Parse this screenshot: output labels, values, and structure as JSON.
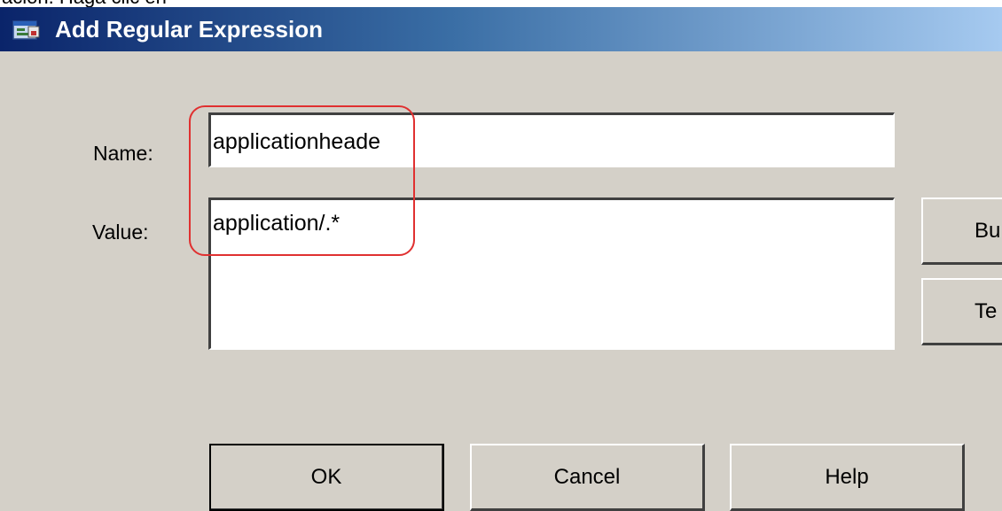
{
  "caption": "ación. Haga clic en",
  "dialog": {
    "title": "Add Regular Expression",
    "title_icon": "regex-app-icon",
    "name_label": "Name:",
    "name_value": "applicationheade",
    "value_label": "Value:",
    "value_value": "application/.*",
    "builder_label": "Bu",
    "test_label": "Te",
    "ok_label": "OK",
    "cancel_label": "Cancel",
    "help_label": "Help"
  },
  "colors": {
    "dialog_bg": "#d4d0c8",
    "titlebar_start": "#0a246a",
    "titlebar_end": "#a6caf0",
    "highlight": "#e03030"
  }
}
